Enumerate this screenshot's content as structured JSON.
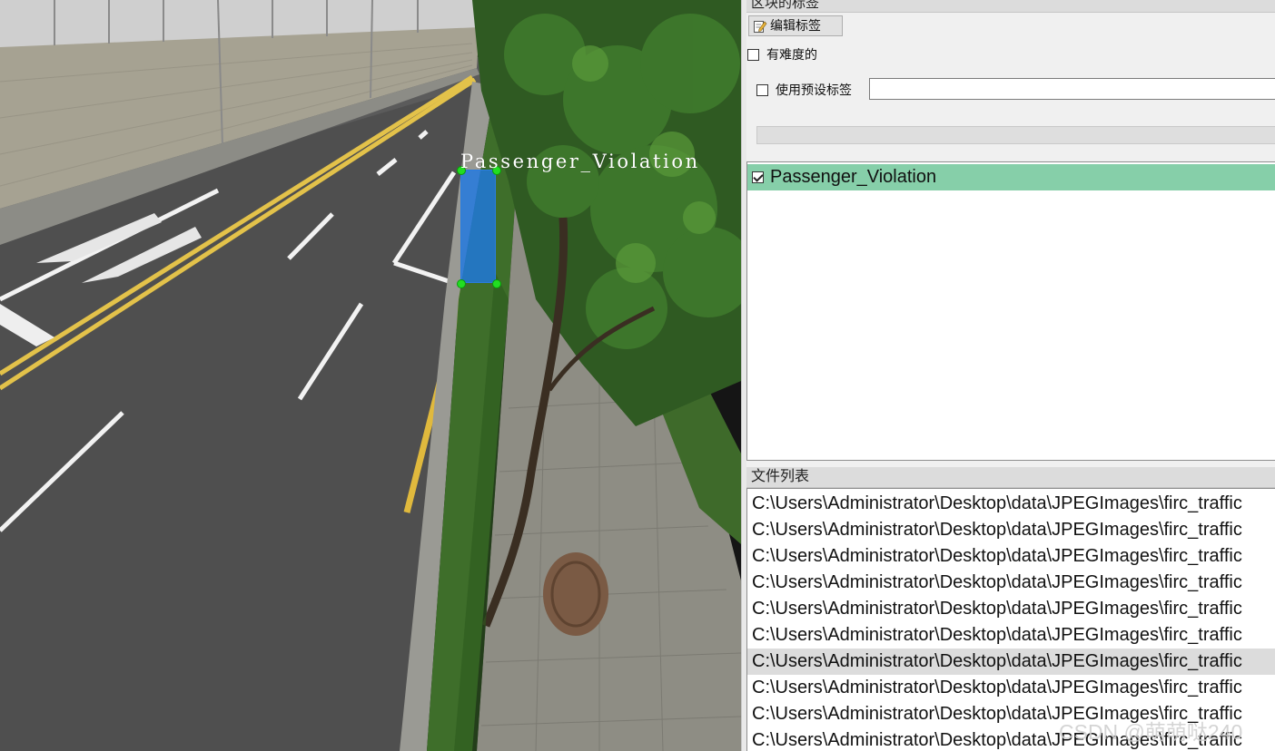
{
  "canvas": {
    "box_label": "Passenger_Violation"
  },
  "labels_dock": {
    "title": "区块的标签",
    "edit_label_button": "编辑标签",
    "difficult_checkbox": "有难度的",
    "use_default_label_checkbox": "使用预设标签",
    "default_label_value": "",
    "labels": [
      {
        "text": "Passenger_Violation",
        "checked": true
      }
    ]
  },
  "file_dock": {
    "title": "文件列表",
    "files": [
      "C:\\Users\\Administrator\\Desktop\\data\\JPEGImages\\firc_traffic",
      "C:\\Users\\Administrator\\Desktop\\data\\JPEGImages\\firc_traffic",
      "C:\\Users\\Administrator\\Desktop\\data\\JPEGImages\\firc_traffic",
      "C:\\Users\\Administrator\\Desktop\\data\\JPEGImages\\firc_traffic",
      "C:\\Users\\Administrator\\Desktop\\data\\JPEGImages\\firc_traffic",
      "C:\\Users\\Administrator\\Desktop\\data\\JPEGImages\\firc_traffic",
      "C:\\Users\\Administrator\\Desktop\\data\\JPEGImages\\firc_traffic",
      "C:\\Users\\Administrator\\Desktop\\data\\JPEGImages\\firc_traffic",
      "C:\\Users\\Administrator\\Desktop\\data\\JPEGImages\\firc_traffic",
      "C:\\Users\\Administrator\\Desktop\\data\\JPEGImages\\firc_traffic"
    ],
    "selected_index": 6
  },
  "watermark": "CSDN @萌萌哒240"
}
